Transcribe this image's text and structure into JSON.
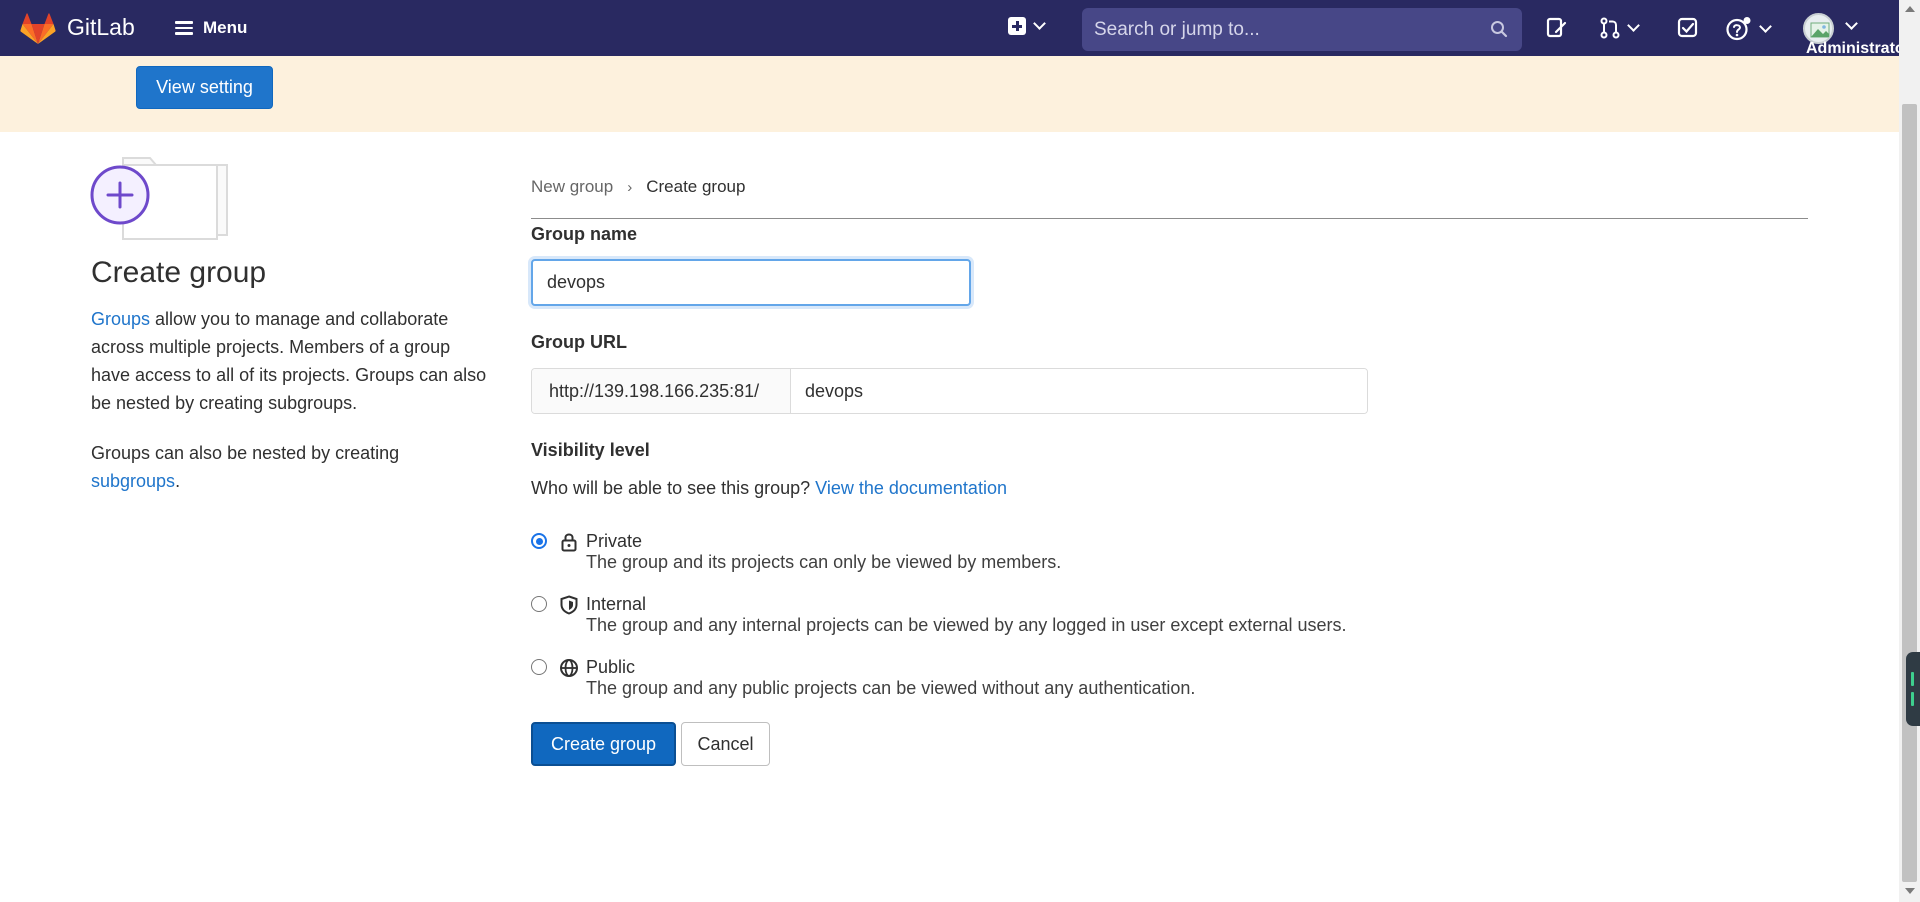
{
  "navbar": {
    "brand": "GitLab",
    "menu_label": "Menu",
    "search_placeholder": "Search or jump to...",
    "user_label": "Administrator",
    "logo_color": "#fc6d26",
    "bg_color": "#292961"
  },
  "banner": {
    "button_label": "View setting",
    "bg_color": "#fdf1dd"
  },
  "sidebar": {
    "title": "Create group",
    "desc1_link": "Groups",
    "desc1_text": " allow you to manage and collaborate across multiple projects. Members of a group have access to all of its projects. Groups can also be nested by creating subgroups.",
    "desc2_text": "Groups can also be nested by creating ",
    "desc2_link": "subgroups",
    "desc2_end": "."
  },
  "breadcrumb": {
    "parent": "New group",
    "separator": "›",
    "current": "Create group"
  },
  "form": {
    "group_name_label": "Group name",
    "group_name_value": "devops",
    "group_url_label": "Group URL",
    "group_url_prefix": "http://139.198.166.235:81/",
    "group_url_value": "devops",
    "visibility_label": "Visibility level",
    "visibility_question": "Who will be able to see this group? ",
    "visibility_doc_link": "View the documentation",
    "visibility_options": [
      {
        "title": "Private",
        "help": "The group and its projects can only be viewed by members.",
        "selected": true,
        "icon": "lock-icon"
      },
      {
        "title": "Internal",
        "help": "The group and any internal projects can be viewed by any logged in user except external users.",
        "selected": false,
        "icon": "shield-icon"
      },
      {
        "title": "Public",
        "help": "The group and any public projects can be viewed without any authentication.",
        "selected": false,
        "icon": "globe-icon"
      }
    ],
    "create_button": "Create group",
    "cancel_button": "Cancel",
    "accent_color": "#1f75cb"
  }
}
